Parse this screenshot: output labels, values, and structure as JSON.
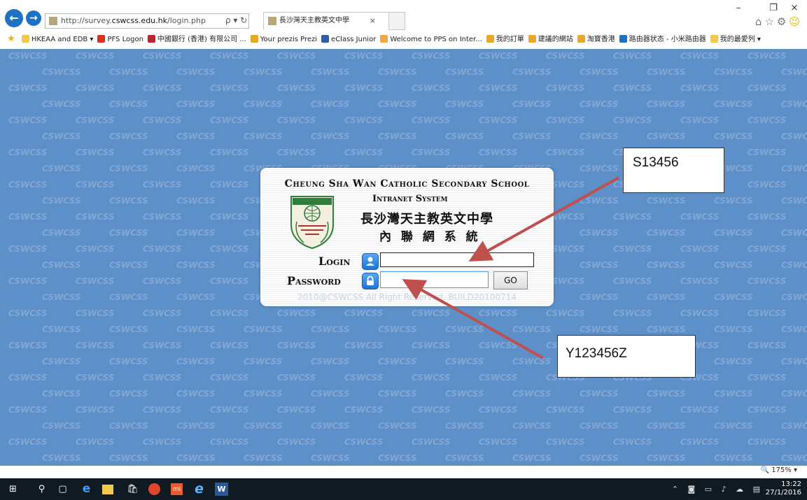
{
  "browser": {
    "address_url_prefix": "http://survey.",
    "address_url_host": "cswcss.edu.hk",
    "address_url_path": "/login.php",
    "address_tools": "ρ ▾ ↻",
    "tab_title": "長沙灣天主教英文中學",
    "tab_close": "×",
    "window_minimize": "–",
    "window_restore": "❐",
    "window_close": "×",
    "back_glyph": "←",
    "forward_glyph": "→"
  },
  "favorites": [
    {
      "label": "HKEAA and EDB ▾",
      "icon": "folder-icon",
      "color": "#f2c94c"
    },
    {
      "label": "PFS Logon",
      "icon": "pfs-icon",
      "color": "#d9331f"
    },
    {
      "label": "中國銀行 (香港) 有限公司 ...",
      "icon": "bank-icon",
      "color": "#c0272d"
    },
    {
      "label": "Your prezis  Prezi",
      "icon": "ie-page-icon",
      "color": "#e7a92a"
    },
    {
      "label": "eClass Junior",
      "icon": "eclass-icon",
      "color": "#2d5fa8"
    },
    {
      "label": "Welcome to PPS on Inter...",
      "icon": "pps-icon",
      "color": "#f2a74a"
    },
    {
      "label": "我的訂單",
      "icon": "ie-page-icon",
      "color": "#e7a92a"
    },
    {
      "label": "建議的網站",
      "icon": "ie-page-icon",
      "color": "#e7a92a"
    },
    {
      "label": "淘寶香港",
      "icon": "ie-page-icon",
      "color": "#e7a92a"
    },
    {
      "label": "路由器状态 - 小米路由器",
      "icon": "router-icon",
      "color": "#1e72c6"
    },
    {
      "label": "我的最愛列 ▾",
      "icon": "folder-icon",
      "color": "#f2c94c"
    }
  ],
  "panel": {
    "school_name_en": "Cheung Sha Wan Catholic Secondary School",
    "system_name_en": "Intranet System",
    "school_name_zh": "長沙灣天主教英文中學",
    "system_name_zh": "內 聯 網 系 統",
    "login_label": "Login",
    "password_label": "Password",
    "login_value": "",
    "password_value": "",
    "go_label": "GO",
    "copyright": "2010@CSWCSS All Right Reserved. BUILD20100714"
  },
  "watermark_text": "CSWCSS",
  "annotations": {
    "login_example": "S13456",
    "password_example": "Y123456Z",
    "arrow_color": "#c0504d"
  },
  "status": {
    "zoom": "🔍 175%  ▾"
  },
  "taskbar": {
    "time": "13:22",
    "date": "27/1/2016"
  },
  "colors": {
    "page_background": "#5d8fc9",
    "browser_accent": "#1e72c6"
  }
}
